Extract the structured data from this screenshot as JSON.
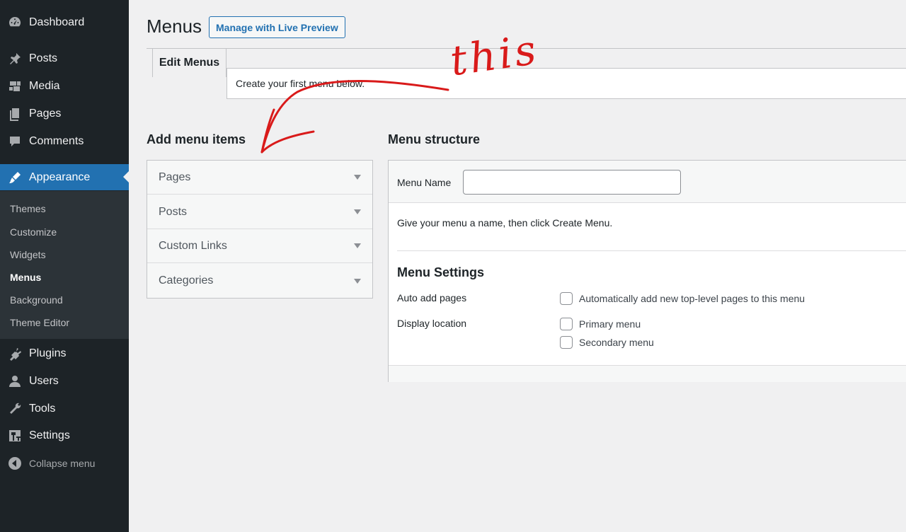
{
  "sidebar": {
    "items": [
      {
        "label": "Dashboard",
        "icon": "dashboard-icon"
      },
      {
        "label": "Posts",
        "icon": "pushpin-icon"
      },
      {
        "label": "Media",
        "icon": "media-icon"
      },
      {
        "label": "Pages",
        "icon": "pages-icon"
      },
      {
        "label": "Comments",
        "icon": "comment-icon"
      },
      {
        "label": "Appearance",
        "icon": "brush-icon",
        "active": true
      },
      {
        "label": "Plugins",
        "icon": "plugin-icon"
      },
      {
        "label": "Users",
        "icon": "user-icon"
      },
      {
        "label": "Tools",
        "icon": "wrench-icon"
      },
      {
        "label": "Settings",
        "icon": "settings-icon"
      }
    ],
    "submenu": [
      "Themes",
      "Customize",
      "Widgets",
      "Menus",
      "Background",
      "Theme Editor"
    ],
    "current_submenu": "Menus",
    "collapse_label": "Collapse menu"
  },
  "header": {
    "title": "Menus",
    "live_preview_label": "Manage with Live Preview"
  },
  "tabs": {
    "edit_menus": "Edit Menus"
  },
  "notice": "Create your first menu below.",
  "add_items": {
    "heading": "Add menu items",
    "sections": [
      "Pages",
      "Posts",
      "Custom Links",
      "Categories"
    ]
  },
  "structure": {
    "heading": "Menu structure",
    "menu_name_label": "Menu Name",
    "menu_name_value": "",
    "hint": "Give your menu a name, then click Create Menu.",
    "settings_heading": "Menu Settings",
    "auto_add_label": "Auto add pages",
    "auto_add_option": "Automatically add new top-level pages to this menu",
    "display_location_label": "Display location",
    "locations": [
      "Primary menu",
      "Secondary menu"
    ]
  },
  "annotation": {
    "text": "this",
    "color": "#d91a1a"
  },
  "colors": {
    "sidebar_bg": "#1d2327",
    "accent": "#2271b1"
  }
}
